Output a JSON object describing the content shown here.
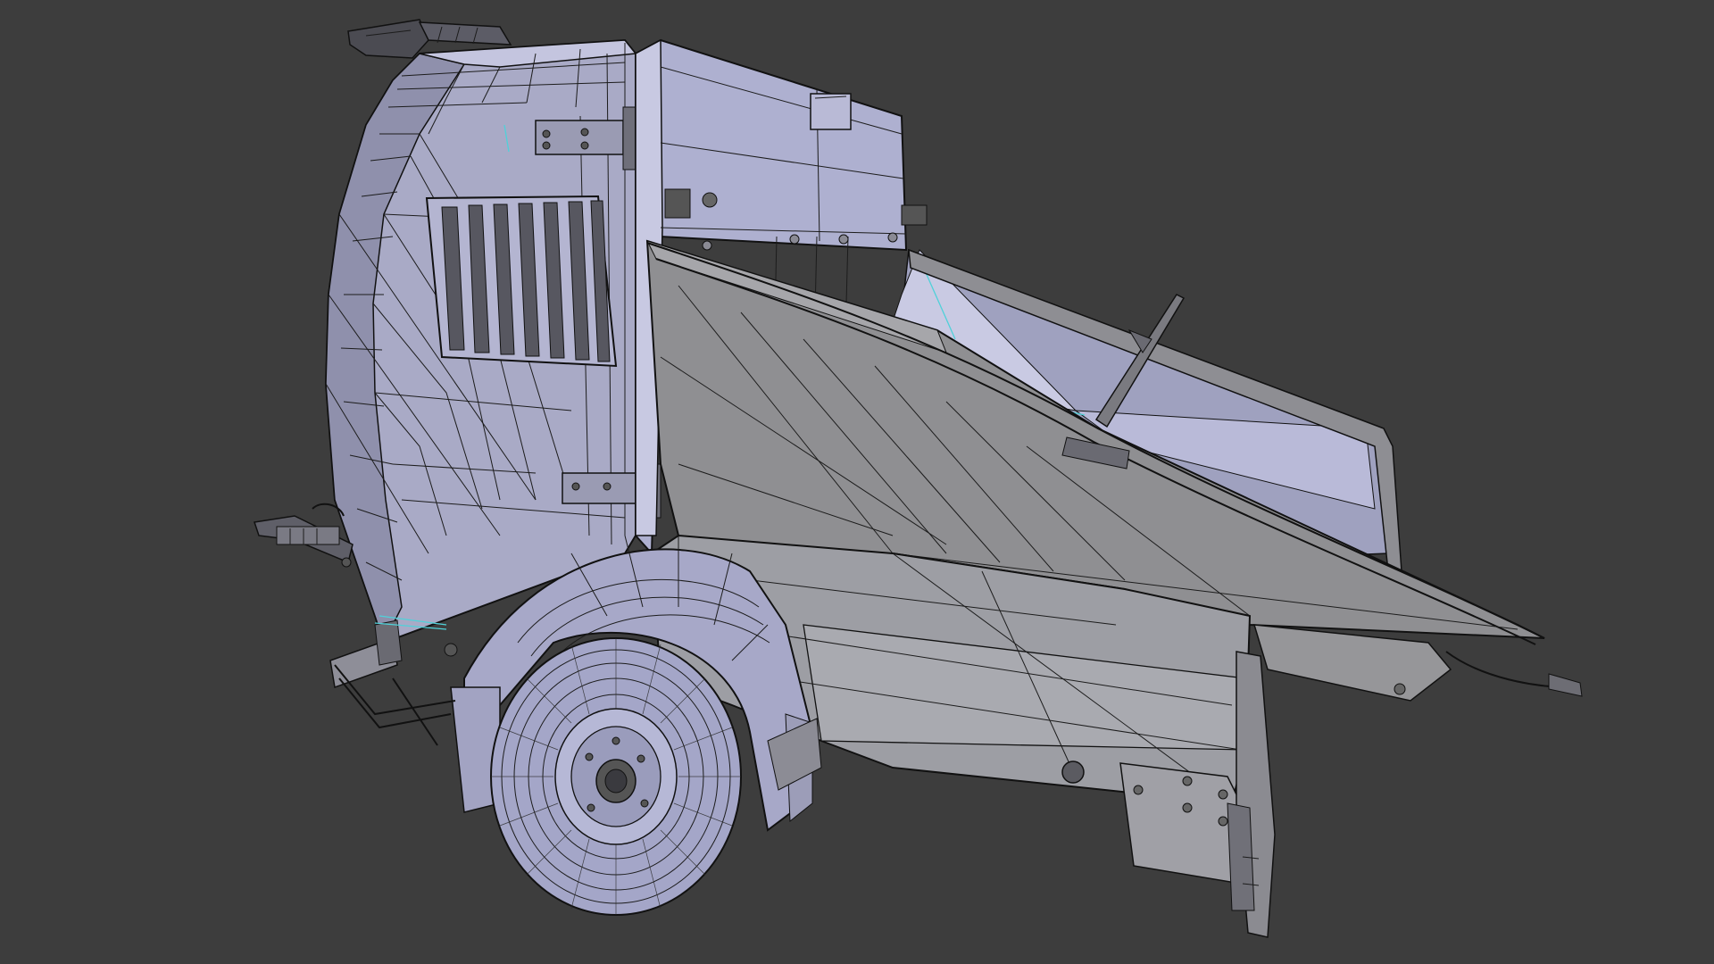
{
  "viewport": {
    "background_color": "#3d3d3d",
    "mode": "wireframe-on-shaded"
  },
  "model": {
    "subject": "towed-wood-chipper",
    "colors": {
      "face_light": "#b8b9d6",
      "face_mid": "#9a9bb8",
      "face_dark": "#7c7d94",
      "face_grey": "#8d8d8f",
      "face_grey_light": "#a8a8ab",
      "wire": "#1c1c1c",
      "seam": "#4fd1d9"
    }
  }
}
